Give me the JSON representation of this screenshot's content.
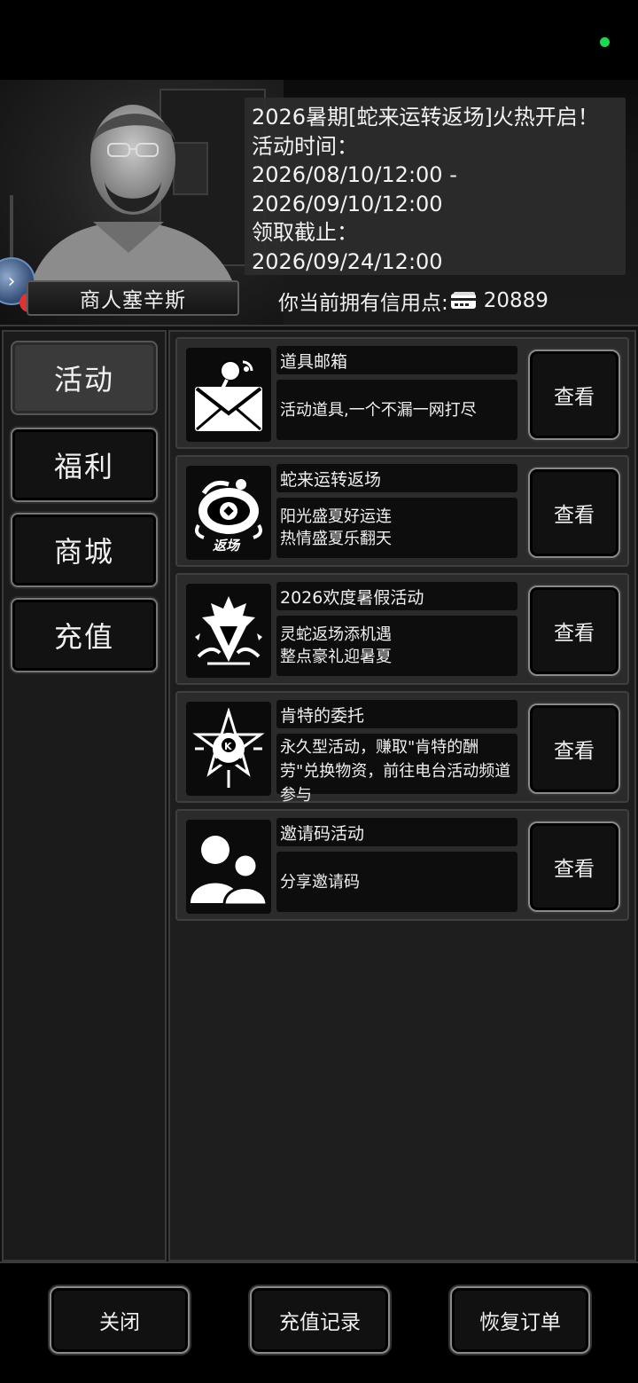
{
  "header": {
    "merchant_name": "商人塞辛斯",
    "announcement": [
      "2026暑期[蛇来运转返场]火热开启！",
      "活动时间：",
      "2026/08/10/12:00 -",
      "2026/09/10/12:00",
      "领取截止：",
      "2026/09/24/12:00"
    ],
    "credit_label": "你当前拥有信用点:",
    "credit_value": "20889",
    "credit_icon": "card-icon"
  },
  "sidebar": {
    "tabs": [
      {
        "label": "活动",
        "active": true
      },
      {
        "label": "福利",
        "active": false
      },
      {
        "label": "商城",
        "active": false
      },
      {
        "label": "充值",
        "active": false
      }
    ]
  },
  "activities": [
    {
      "title": "道具邮箱",
      "desc": "活动道具,一个不漏一网打尽",
      "icon": "mail-icon",
      "button": "查看"
    },
    {
      "title": "蛇来运转返场",
      "desc": "阳光盛夏好运连\n热情盛夏乐翻天",
      "icon": "snake-return-icon",
      "button": "查看"
    },
    {
      "title": "2026欢度暑假活动",
      "desc": "灵蛇返场添机遇\n整点豪礼迎暑夏",
      "icon": "summer-event-icon",
      "button": "查看"
    },
    {
      "title": "肯特的委托",
      "desc": "永久型活动，赚取\"肯特的酬劳\"兑换物资，前往电台活动频道参与",
      "icon": "kent-badge-icon",
      "button": "查看"
    },
    {
      "title": "邀请码活动",
      "desc": "分享邀请码",
      "icon": "people-icon",
      "button": "查看"
    }
  ],
  "footer": {
    "close": "关闭",
    "recharge_history": "充值记录",
    "restore_orders": "恢复订单"
  },
  "colors": {
    "status_dot": "#1fd655",
    "background": "#000000",
    "panel": "#1e1e1e"
  }
}
